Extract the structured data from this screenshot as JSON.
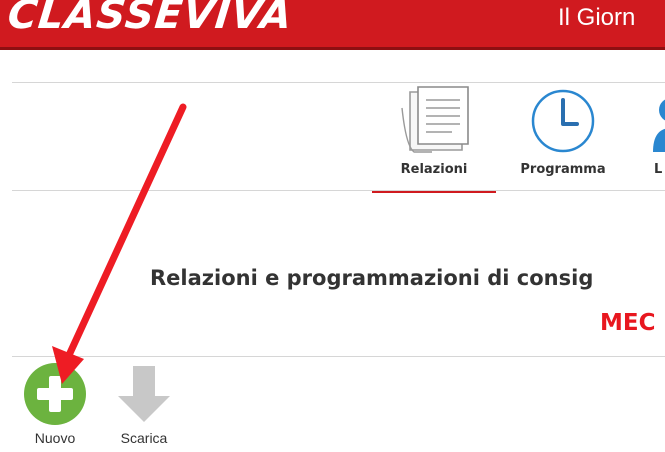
{
  "header": {
    "logo_text": "CLASSEVIVA",
    "subtitle": "Il Giorn"
  },
  "tabs": [
    {
      "label": "Relazioni",
      "icon": "document-icon",
      "active": true
    },
    {
      "label": "Programma",
      "icon": "clock-icon",
      "active": false
    },
    {
      "label": "L",
      "icon": "user-icon",
      "active": false
    }
  ],
  "page": {
    "title": "Relazioni e programmazioni di consig",
    "class_name": "MEC"
  },
  "toolbar": {
    "new_label": "Nuovo",
    "new_icon": "plus-circle-icon",
    "download_label": "Scarica",
    "download_icon": "download-arrow-icon"
  },
  "colors": {
    "brand": "#d01a1f",
    "accent_red": "#e8171f",
    "new_green": "#6cb33f",
    "icon_blue": "#2a87d0",
    "disabled_gray": "#c8c8c8",
    "annotation_arrow": "#ee1c24"
  }
}
